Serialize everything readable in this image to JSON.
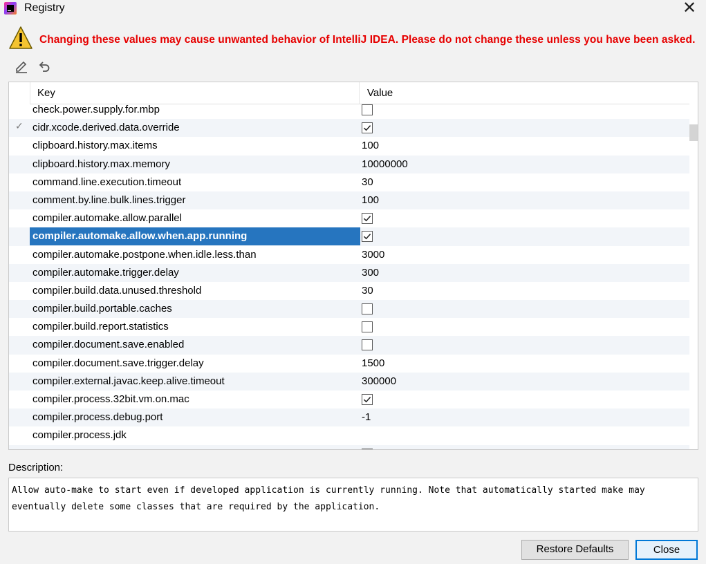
{
  "window": {
    "title": "Registry",
    "close_glyph": "✕"
  },
  "warning": {
    "text": "Changing these values may cause unwanted behavior of IntelliJ IDEA. Please do not change these unless you have been asked.",
    "color": "#e60000"
  },
  "toolbar": {
    "edit_icon": "pencil-icon",
    "revert_icon": "undo-icon"
  },
  "table": {
    "columns": [
      "Key",
      "Value"
    ],
    "rows": [
      {
        "key": "check.power.supply.for.mbp",
        "type": "bool",
        "value": false,
        "modified": false,
        "selected": false
      },
      {
        "key": "cidr.xcode.derived.data.override",
        "type": "bool",
        "value": true,
        "modified": true,
        "selected": false
      },
      {
        "key": "clipboard.history.max.items",
        "type": "text",
        "value": "100",
        "modified": false,
        "selected": false
      },
      {
        "key": "clipboard.history.max.memory",
        "type": "text",
        "value": "10000000",
        "modified": false,
        "selected": false
      },
      {
        "key": "command.line.execution.timeout",
        "type": "text",
        "value": "30",
        "modified": false,
        "selected": false
      },
      {
        "key": "comment.by.line.bulk.lines.trigger",
        "type": "text",
        "value": "100",
        "modified": false,
        "selected": false
      },
      {
        "key": "compiler.automake.allow.parallel",
        "type": "bool",
        "value": true,
        "modified": false,
        "selected": false
      },
      {
        "key": "compiler.automake.allow.when.app.running",
        "type": "bool",
        "value": true,
        "modified": false,
        "selected": true
      },
      {
        "key": "compiler.automake.postpone.when.idle.less.than",
        "type": "text",
        "value": "3000",
        "modified": false,
        "selected": false
      },
      {
        "key": "compiler.automake.trigger.delay",
        "type": "text",
        "value": "300",
        "modified": false,
        "selected": false
      },
      {
        "key": "compiler.build.data.unused.threshold",
        "type": "text",
        "value": "30",
        "modified": false,
        "selected": false
      },
      {
        "key": "compiler.build.portable.caches",
        "type": "bool",
        "value": false,
        "modified": false,
        "selected": false
      },
      {
        "key": "compiler.build.report.statistics",
        "type": "bool",
        "value": false,
        "modified": false,
        "selected": false
      },
      {
        "key": "compiler.document.save.enabled",
        "type": "bool",
        "value": false,
        "modified": false,
        "selected": false
      },
      {
        "key": "compiler.document.save.trigger.delay",
        "type": "text",
        "value": "1500",
        "modified": false,
        "selected": false
      },
      {
        "key": "compiler.external.javac.keep.alive.timeout",
        "type": "text",
        "value": "300000",
        "modified": false,
        "selected": false
      },
      {
        "key": "compiler.process.32bit.vm.on.mac",
        "type": "bool",
        "value": true,
        "modified": false,
        "selected": false
      },
      {
        "key": "compiler.process.debug.port",
        "type": "text",
        "value": "-1",
        "modified": false,
        "selected": false
      },
      {
        "key": "compiler.process.jdk",
        "type": "text",
        "value": "",
        "modified": false,
        "selected": false
      },
      {
        "key": "",
        "type": "bool",
        "value": true,
        "modified": false,
        "selected": false
      }
    ],
    "modified_mark": "✓"
  },
  "description": {
    "label": "Description:",
    "text": "Allow auto-make to start even if developed application is currently running. Note that automatically started make may eventually delete some classes that are required by the application."
  },
  "buttons": {
    "restore_defaults": "Restore Defaults",
    "close": "Close"
  },
  "colors": {
    "selection": "#2675bf",
    "focus_border": "#0078d7"
  }
}
